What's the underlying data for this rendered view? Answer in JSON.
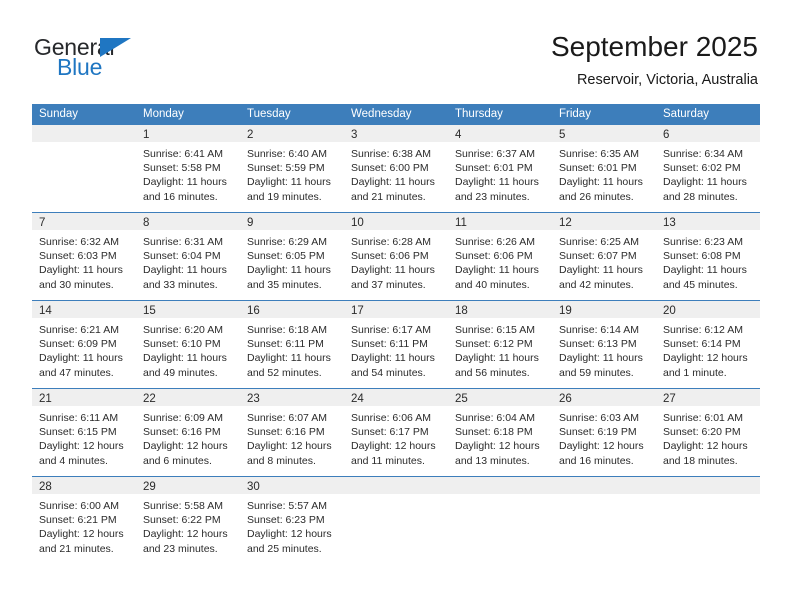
{
  "brand": {
    "name_top": "General",
    "name_bottom": "Blue",
    "accent_color": "#1f76c2"
  },
  "header": {
    "title": "September 2025",
    "subtitle": "Reservoir, Victoria, Australia"
  },
  "theme": {
    "header_row_color": "#3d7ebb",
    "day_band_color": "#efefef",
    "text_color": "#2b2b2b"
  },
  "weekdays": [
    "Sunday",
    "Monday",
    "Tuesday",
    "Wednesday",
    "Thursday",
    "Friday",
    "Saturday"
  ],
  "weeks": [
    [
      {
        "day": "",
        "lines": []
      },
      {
        "day": "1",
        "lines": [
          "Sunrise: 6:41 AM",
          "Sunset: 5:58 PM",
          "Daylight: 11 hours",
          "and 16 minutes."
        ]
      },
      {
        "day": "2",
        "lines": [
          "Sunrise: 6:40 AM",
          "Sunset: 5:59 PM",
          "Daylight: 11 hours",
          "and 19 minutes."
        ]
      },
      {
        "day": "3",
        "lines": [
          "Sunrise: 6:38 AM",
          "Sunset: 6:00 PM",
          "Daylight: 11 hours",
          "and 21 minutes."
        ]
      },
      {
        "day": "4",
        "lines": [
          "Sunrise: 6:37 AM",
          "Sunset: 6:01 PM",
          "Daylight: 11 hours",
          "and 23 minutes."
        ]
      },
      {
        "day": "5",
        "lines": [
          "Sunrise: 6:35 AM",
          "Sunset: 6:01 PM",
          "Daylight: 11 hours",
          "and 26 minutes."
        ]
      },
      {
        "day": "6",
        "lines": [
          "Sunrise: 6:34 AM",
          "Sunset: 6:02 PM",
          "Daylight: 11 hours",
          "and 28 minutes."
        ]
      }
    ],
    [
      {
        "day": "7",
        "lines": [
          "Sunrise: 6:32 AM",
          "Sunset: 6:03 PM",
          "Daylight: 11 hours",
          "and 30 minutes."
        ]
      },
      {
        "day": "8",
        "lines": [
          "Sunrise: 6:31 AM",
          "Sunset: 6:04 PM",
          "Daylight: 11 hours",
          "and 33 minutes."
        ]
      },
      {
        "day": "9",
        "lines": [
          "Sunrise: 6:29 AM",
          "Sunset: 6:05 PM",
          "Daylight: 11 hours",
          "and 35 minutes."
        ]
      },
      {
        "day": "10",
        "lines": [
          "Sunrise: 6:28 AM",
          "Sunset: 6:06 PM",
          "Daylight: 11 hours",
          "and 37 minutes."
        ]
      },
      {
        "day": "11",
        "lines": [
          "Sunrise: 6:26 AM",
          "Sunset: 6:06 PM",
          "Daylight: 11 hours",
          "and 40 minutes."
        ]
      },
      {
        "day": "12",
        "lines": [
          "Sunrise: 6:25 AM",
          "Sunset: 6:07 PM",
          "Daylight: 11 hours",
          "and 42 minutes."
        ]
      },
      {
        "day": "13",
        "lines": [
          "Sunrise: 6:23 AM",
          "Sunset: 6:08 PM",
          "Daylight: 11 hours",
          "and 45 minutes."
        ]
      }
    ],
    [
      {
        "day": "14",
        "lines": [
          "Sunrise: 6:21 AM",
          "Sunset: 6:09 PM",
          "Daylight: 11 hours",
          "and 47 minutes."
        ]
      },
      {
        "day": "15",
        "lines": [
          "Sunrise: 6:20 AM",
          "Sunset: 6:10 PM",
          "Daylight: 11 hours",
          "and 49 minutes."
        ]
      },
      {
        "day": "16",
        "lines": [
          "Sunrise: 6:18 AM",
          "Sunset: 6:11 PM",
          "Daylight: 11 hours",
          "and 52 minutes."
        ]
      },
      {
        "day": "17",
        "lines": [
          "Sunrise: 6:17 AM",
          "Sunset: 6:11 PM",
          "Daylight: 11 hours",
          "and 54 minutes."
        ]
      },
      {
        "day": "18",
        "lines": [
          "Sunrise: 6:15 AM",
          "Sunset: 6:12 PM",
          "Daylight: 11 hours",
          "and 56 minutes."
        ]
      },
      {
        "day": "19",
        "lines": [
          "Sunrise: 6:14 AM",
          "Sunset: 6:13 PM",
          "Daylight: 11 hours",
          "and 59 minutes."
        ]
      },
      {
        "day": "20",
        "lines": [
          "Sunrise: 6:12 AM",
          "Sunset: 6:14 PM",
          "Daylight: 12 hours",
          "and 1 minute."
        ]
      }
    ],
    [
      {
        "day": "21",
        "lines": [
          "Sunrise: 6:11 AM",
          "Sunset: 6:15 PM",
          "Daylight: 12 hours",
          "and 4 minutes."
        ]
      },
      {
        "day": "22",
        "lines": [
          "Sunrise: 6:09 AM",
          "Sunset: 6:16 PM",
          "Daylight: 12 hours",
          "and 6 minutes."
        ]
      },
      {
        "day": "23",
        "lines": [
          "Sunrise: 6:07 AM",
          "Sunset: 6:16 PM",
          "Daylight: 12 hours",
          "and 8 minutes."
        ]
      },
      {
        "day": "24",
        "lines": [
          "Sunrise: 6:06 AM",
          "Sunset: 6:17 PM",
          "Daylight: 12 hours",
          "and 11 minutes."
        ]
      },
      {
        "day": "25",
        "lines": [
          "Sunrise: 6:04 AM",
          "Sunset: 6:18 PM",
          "Daylight: 12 hours",
          "and 13 minutes."
        ]
      },
      {
        "day": "26",
        "lines": [
          "Sunrise: 6:03 AM",
          "Sunset: 6:19 PM",
          "Daylight: 12 hours",
          "and 16 minutes."
        ]
      },
      {
        "day": "27",
        "lines": [
          "Sunrise: 6:01 AM",
          "Sunset: 6:20 PM",
          "Daylight: 12 hours",
          "and 18 minutes."
        ]
      }
    ],
    [
      {
        "day": "28",
        "lines": [
          "Sunrise: 6:00 AM",
          "Sunset: 6:21 PM",
          "Daylight: 12 hours",
          "and 21 minutes."
        ]
      },
      {
        "day": "29",
        "lines": [
          "Sunrise: 5:58 AM",
          "Sunset: 6:22 PM",
          "Daylight: 12 hours",
          "and 23 minutes."
        ]
      },
      {
        "day": "30",
        "lines": [
          "Sunrise: 5:57 AM",
          "Sunset: 6:23 PM",
          "Daylight: 12 hours",
          "and 25 minutes."
        ]
      },
      {
        "day": "",
        "lines": []
      },
      {
        "day": "",
        "lines": []
      },
      {
        "day": "",
        "lines": []
      },
      {
        "day": "",
        "lines": []
      }
    ]
  ]
}
